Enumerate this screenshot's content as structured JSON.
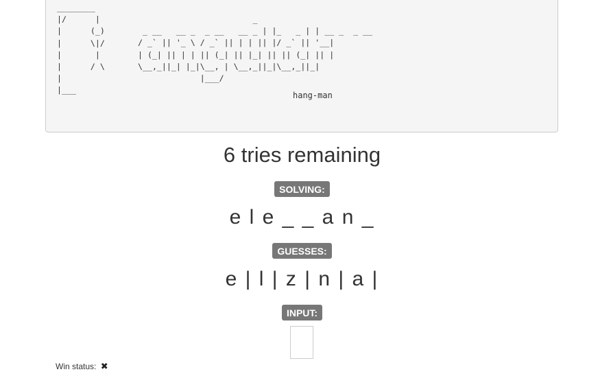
{
  "header": {
    "gallows_art": "________\n|/      |\n|      (_)\n|      \\|/\n|       |\n|      / \\\n|\n|___",
    "logo_art": "                        _\n _ __   __ _  _ __   __ _ | |_   _ | | __ _  _ __\n/ _` || '_ \\ / _` || | | || |/ _` || '__|\n| (_| || | | || (_| || |_| || || (_| || |\n\\__,_||_| |_|\\__, | \\__,_||_|\\__,_||_|\n             |___/",
    "subtitle": "hang-man"
  },
  "game": {
    "tries_text": "6 tries remaining",
    "solving_label": "SOLVING:",
    "solving_word": "e l e _ _ a n _",
    "guesses_label": "GUESSES:",
    "guesses": "e | l | z | n | a |",
    "input_label": "INPUT:",
    "input_value": ""
  },
  "status": {
    "win_label": "Win status:",
    "win_icon": "✖"
  }
}
